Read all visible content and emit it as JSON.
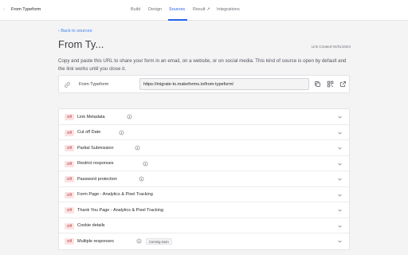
{
  "header": {
    "breadcrumb_sep": "›",
    "form_name": "From Typeform",
    "tabs": [
      {
        "label": "Build",
        "active": false
      },
      {
        "label": "Design",
        "active": false
      },
      {
        "label": "Sources",
        "active": true
      },
      {
        "label": "Result ↗",
        "active": false
      },
      {
        "label": "Integrations",
        "active": false
      }
    ]
  },
  "sources": {
    "back_label": "‹ Back to sources",
    "title": "From Ty...",
    "link_created": "Link Created 04/01/2024",
    "description": "Copy and paste this URL to share your form in an email, on a website, or on social media. This kind of source is open by default and the link works until you close it.",
    "source_name": "From Typeform",
    "url": "https://migrate-to.makeforms.io/from-typeform/"
  },
  "settings": {
    "badge": "Off",
    "coming_soon": "Coming soon",
    "rows": [
      {
        "label": "Link Metadata",
        "info": true,
        "soon": false
      },
      {
        "label": "Cut off Date",
        "info": true,
        "soon": false
      },
      {
        "label": "Partial Submission",
        "info": true,
        "soon": false
      },
      {
        "label": "Restrict responses",
        "info": true,
        "soon": false
      },
      {
        "label": "Password protection",
        "info": true,
        "soon": false
      },
      {
        "label": "Form Page - Analytics & Pixel Tracking",
        "info": false,
        "soon": false
      },
      {
        "label": "Thank You Page - Analytics & Pixel Tracking",
        "info": false,
        "soon": false
      },
      {
        "label": "Cookie details",
        "info": false,
        "soon": false
      },
      {
        "label": "Multiple responses",
        "info": true,
        "soon": true
      }
    ]
  },
  "colors": {
    "accent": "#2563eb",
    "off_badge_bg": "#fde2e2",
    "off_badge_text": "#b91c1c"
  }
}
